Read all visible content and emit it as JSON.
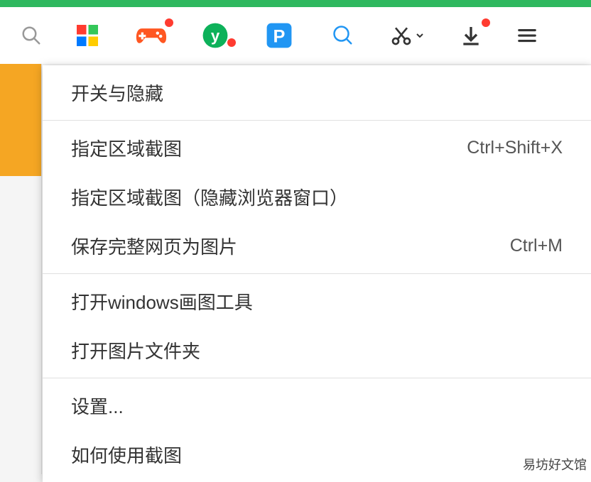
{
  "toolbar": {
    "icons": {
      "search": "search-icon",
      "apps": "apps-grid-icon",
      "games": "gamepad-icon",
      "y_green": "y-circle-icon",
      "p_blue": "p-square-icon",
      "circle_blue": "circle-search-icon",
      "scissors": "scissors-icon",
      "download": "download-icon",
      "menu": "hamburger-menu-icon"
    }
  },
  "menu": {
    "group1": {
      "toggle_hide": "开关与隐藏"
    },
    "group2": {
      "capture_area": "指定区域截图",
      "capture_area_shortcut": "Ctrl+Shift+X",
      "capture_area_hidden": "指定区域截图（隐藏浏览器窗口）",
      "save_page_image": "保存完整网页为图片",
      "save_page_image_shortcut": "Ctrl+M"
    },
    "group3": {
      "open_paint": "打开windows画图工具",
      "open_folder": "打开图片文件夹"
    },
    "group4": {
      "settings": "设置...",
      "how_to": "如何使用截图"
    }
  },
  "watermark": "易坊好文馆"
}
